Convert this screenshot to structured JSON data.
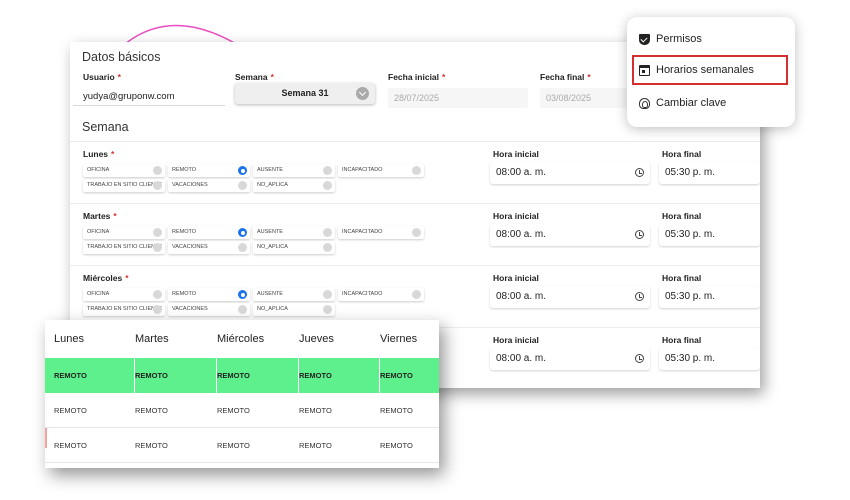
{
  "form": {
    "section_basic": "Datos básicos",
    "usuario": {
      "label": "Usuario",
      "required": "*",
      "value": "yudya@gruponw.com"
    },
    "semana": {
      "label": "Semana",
      "required": "*",
      "value": "Semana 31"
    },
    "fecha_inicial": {
      "label": "Fecha inicial",
      "required": "*",
      "value": "28/07/2025"
    },
    "fecha_final": {
      "label": "Fecha final",
      "required": "*",
      "value": "03/08/2025"
    },
    "section_week": "Semana",
    "options": {
      "oficina": "OFICINA",
      "remoto": "REMOTO",
      "ausente": "AUSENTE",
      "incapacitado": "INCAPACITADO",
      "trabajo_sitio": "TRABAJO EN SITIO CLIENTE",
      "vacaciones": "VACACIONES",
      "no_aplica": "NO_APLICA"
    },
    "hora_inicial_label": "Hora inicial",
    "hora_final_label": "Hora final",
    "days": [
      {
        "name": "Lunes",
        "required": "*",
        "hora_inicial": "08:00 a. m.",
        "hora_final": "05:30 p. m."
      },
      {
        "name": "Martes",
        "required": "*",
        "hora_inicial": "08:00 a. m.",
        "hora_final": "05:30 p. m."
      },
      {
        "name": "Miércoles",
        "required": "*",
        "hora_inicial": "08:00 a. m.",
        "hora_final": "05:30 p. m."
      },
      {
        "name": "",
        "required": "",
        "hora_inicial": "08:00 a. m.",
        "hora_final": "05:30 p. m."
      }
    ]
  },
  "menu": {
    "items": [
      {
        "label": "Permisos",
        "icon": "shield-check-icon"
      },
      {
        "label": "Horarios semanales",
        "icon": "calendar-icon"
      },
      {
        "label": "Cambiar clave",
        "icon": "fingerprint-icon"
      }
    ],
    "highlight_color": "#d32f2f"
  },
  "summary_table": {
    "headers": [
      "Lunes",
      "Martes",
      "Miércoles",
      "Jueves",
      "Viernes"
    ],
    "rows": [
      [
        "REMOTO",
        "REMOTO",
        "REMOTO",
        "REMOTO",
        "REMOTO"
      ],
      [
        "REMOTO",
        "REMOTO",
        "REMOTO",
        "REMOTO",
        "REMOTO"
      ],
      [
        "REMOTO",
        "REMOTO",
        "REMOTO",
        "REMOTO",
        "REMOTO"
      ]
    ],
    "highlight_color": "#5ef08c"
  }
}
